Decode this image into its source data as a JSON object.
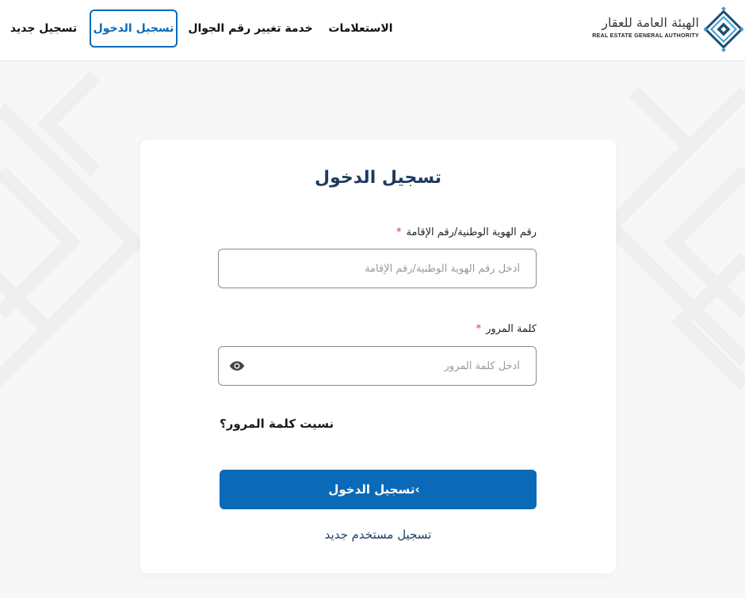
{
  "brand": {
    "name_ar": "الهيئة العامة للعقار",
    "name_en": "REAL ESTATE GENERAL AUTHORITY",
    "icon": "diamond-lattice-logo"
  },
  "nav": {
    "inquiries": "الاستعلامات",
    "change_mobile": "خدمة تغيير رقم الجوال",
    "login": "تسجيل الدخول",
    "register": "تسجيل جديد"
  },
  "form": {
    "title": "تسجيل الدخول",
    "id_label": "رقم الهوية الوطنية/رقم الإقامة",
    "id_placeholder": "أدخل رقم الهوية الوطنية/رقم الإقامة",
    "id_value": "",
    "password_label": "كلمة المرور",
    "password_placeholder": "أدخل كلمة المرور",
    "password_value": "",
    "required_mark": "*",
    "forgot_password": "نسيت كلمة المرور؟",
    "login_button": "تسجيل الدخول",
    "register_link": "تسجيل مستخدم جديد"
  },
  "icons": {
    "show_password": "eye-icon",
    "login_chevron": "chevron-left-icon"
  },
  "colors": {
    "primary": "#0a6ab8",
    "title": "#1e3a5f",
    "required": "#d23b3b"
  }
}
